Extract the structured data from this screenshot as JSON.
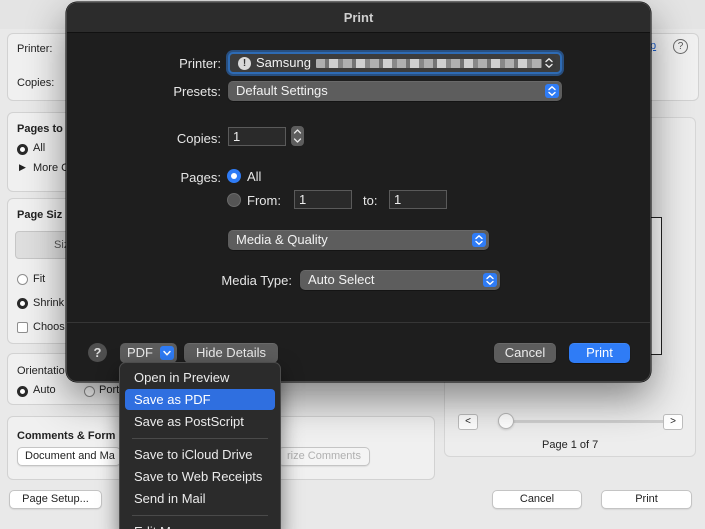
{
  "background": {
    "printer_label": "Printer:",
    "copies_label": "Copies:",
    "help_link": "p",
    "pages_header": "Pages to",
    "pages_all": "All",
    "pages_more": "More C",
    "page_size_header": "Page Siz",
    "size_button": "Siz",
    "fit": "Fit",
    "shrink": "Shrink",
    "choose": "Choos",
    "orientation_label": "Orientatio",
    "orientation_auto": "Auto",
    "orientation_portrait": "Port",
    "comments_header": "Comments & Form",
    "comments_popup": "Document and Ma",
    "summarize_button": "rize Comments",
    "page_setup_button": "Page Setup...",
    "cancel_button": "Cancel",
    "print_button": "Print",
    "page_indicator": "Page 1 of 7",
    "prev_button": "<",
    "next_button": ">"
  },
  "sheet": {
    "title": "Print",
    "printer_label": "Printer:",
    "printer_value": "Samsung",
    "printer_warning_icon": "!",
    "presets_label": "Presets:",
    "presets_value": "Default Settings",
    "copies_label": "Copies:",
    "copies_value": "1",
    "pages_label": "Pages:",
    "pages_all": "All",
    "pages_from": "From:",
    "pages_from_value": "1",
    "pages_to": "to:",
    "pages_to_value": "1",
    "panel_value": "Media & Quality",
    "media_type_label": "Media Type:",
    "media_type_value": "Auto Select",
    "help_button": "?",
    "pdf_button": "PDF",
    "hide_details_button": "Hide Details",
    "cancel_button": "Cancel",
    "print_button": "Print"
  },
  "pdf_menu": {
    "items": [
      "Open in Preview",
      "Save as PDF",
      "Save as PostScript",
      "Save to iCloud Drive",
      "Save to Web Receipts",
      "Send in Mail",
      "Edit M"
    ],
    "highlighted_index": 1
  },
  "colors": {
    "accent": "#2f7cf6",
    "sheet_bg": "#1e1e1e",
    "menu_highlight": "#2f6fe0"
  }
}
